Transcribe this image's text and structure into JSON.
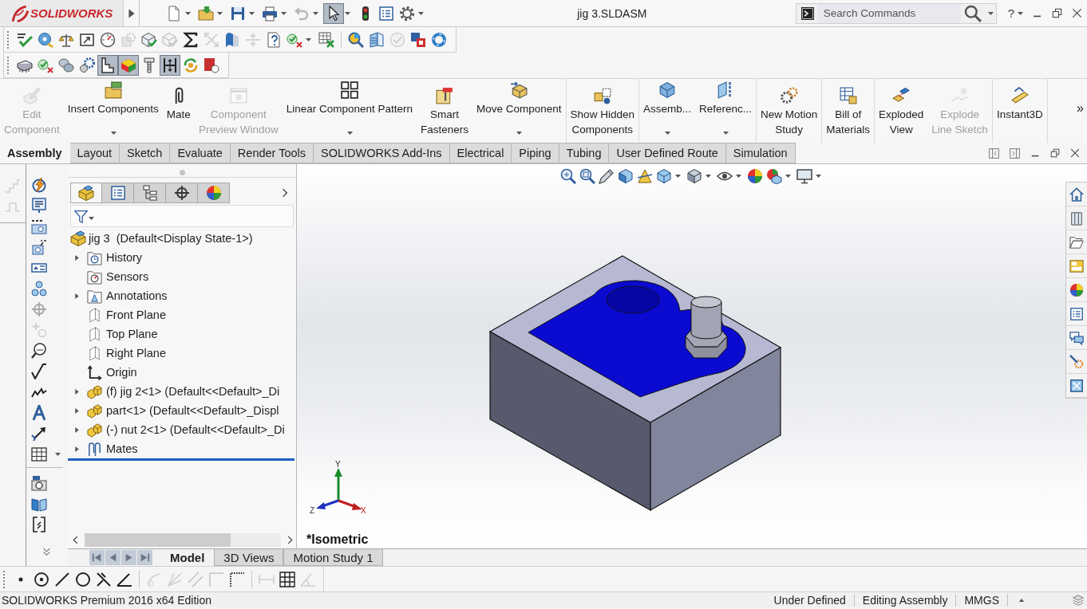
{
  "title_bar": {
    "logo_text": "SOLIDWORKS",
    "title": "jig 3.SLDASM",
    "search": {
      "placeholder": "Search Commands"
    },
    "help": "?"
  },
  "standard_toolbar": [
    {
      "disabled": false,
      "on": false
    },
    {
      "disabled": false,
      "on": false
    },
    {
      "disabled": false,
      "on": false
    },
    {
      "disabled": false,
      "on": false
    },
    {
      "disabled": true,
      "on": false
    },
    {
      "disabled": false,
      "on": true
    },
    {
      "disabled": false,
      "on": false
    },
    {
      "disabled": false,
      "on": false
    },
    {
      "disabled": false,
      "on": false
    }
  ],
  "toolbar_2": {
    "groups": [
      [
        {
          "disabled": false
        },
        {
          "disabled": false
        },
        {
          "disabled": false
        },
        {
          "disabled": false
        },
        {
          "disabled": false
        },
        {
          "disabled": true
        },
        {
          "disabled": false
        },
        {
          "disabled": true
        },
        {
          "disabled": false
        },
        {
          "disabled": true
        },
        {
          "disabled": false
        },
        {
          "disabled": true
        },
        {
          "disabled": false
        },
        {
          "disabled": false
        },
        {
          "disabled": false
        }
      ],
      [
        {
          "disabled": false
        },
        {
          "disabled": false
        },
        {
          "disabled": true
        },
        {
          "disabled": false
        },
        {
          "disabled": false
        }
      ]
    ]
  },
  "toolbar_3": [
    {
      "on": false
    },
    {
      "on": false
    },
    {
      "on": false
    },
    {
      "on": false
    },
    {
      "on": true
    },
    {
      "on": true
    },
    {
      "on": false
    },
    {
      "on": true
    },
    {
      "on": false
    },
    {
      "on": false
    }
  ],
  "command_manager": {
    "groups": [
      [
        {
          "label": "Edit\nComponent",
          "disabled": true,
          "dropdown": false
        },
        {
          "label": "Insert Components",
          "disabled": false,
          "dropdown": true
        },
        {
          "label": "Mate",
          "disabled": false,
          "dropdown": false
        },
        {
          "label": "Component\nPreview Window",
          "disabled": true,
          "dropdown": false
        },
        {
          "label": "Linear Component Pattern",
          "disabled": false,
          "dropdown": true
        },
        {
          "label": "Smart\nFasteners",
          "disabled": false,
          "dropdown": false
        },
        {
          "label": "Move Component",
          "disabled": false,
          "dropdown": true
        }
      ],
      [
        {
          "label": "Show Hidden\nComponents",
          "disabled": false,
          "dropdown": false
        }
      ],
      [
        {
          "label": "Assemb...",
          "disabled": false,
          "dropdown": true
        },
        {
          "label": "Referenc...",
          "disabled": false,
          "dropdown": true
        }
      ],
      [
        {
          "label": "New Motion\nStudy",
          "disabled": false,
          "dropdown": false
        }
      ],
      [
        {
          "label": "Bill of\nMaterials",
          "disabled": false,
          "dropdown": false
        }
      ],
      [
        {
          "label": "Exploded\nView",
          "disabled": false,
          "dropdown": false
        },
        {
          "label": "Explode\nLine Sketch",
          "disabled": true,
          "dropdown": false
        }
      ],
      [
        {
          "label": "Instant3D",
          "disabled": false,
          "dropdown": false
        }
      ]
    ],
    "more": "»"
  },
  "tabs": [
    {
      "label": "Assembly",
      "selected": true
    },
    {
      "label": "Layout",
      "selected": false
    },
    {
      "label": "Sketch",
      "selected": false
    },
    {
      "label": "Evaluate",
      "selected": false
    },
    {
      "label": "Render Tools",
      "selected": false
    },
    {
      "label": "SOLIDWORKS Add-Ins",
      "selected": false
    },
    {
      "label": "Electrical",
      "selected": false
    },
    {
      "label": "Piping",
      "selected": false
    },
    {
      "label": "Tubing",
      "selected": false
    },
    {
      "label": "User Defined Route",
      "selected": false
    },
    {
      "label": "Simulation",
      "selected": false
    }
  ],
  "left_toolbar": [
    {
      "disabled": true
    },
    {
      "disabled": true
    }
  ],
  "annotation_toolbar": {
    "groups": [
      [
        {
          "disabled": false
        },
        {
          "disabled": false
        },
        {
          "disabled": false
        },
        {
          "disabled": false
        },
        {
          "disabled": false
        },
        {
          "disabled": false
        },
        {
          "disabled": true
        },
        {
          "disabled": true
        },
        {
          "disabled": false
        },
        {
          "disabled": false
        },
        {
          "disabled": false
        },
        {
          "disabled": false
        },
        {
          "disabled": false
        },
        {
          "disabled": false
        }
      ],
      [
        {
          "disabled": false
        },
        {
          "disabled": false
        },
        {
          "disabled": false
        }
      ]
    ]
  },
  "feature_manager": {
    "tabs": [
      {
        "selected": true
      },
      {
        "selected": false
      },
      {
        "selected": false
      },
      {
        "selected": false
      },
      {
        "selected": false
      }
    ],
    "tree": {
      "label": "jig 3  (Default<Display State-1>)",
      "children": [
        {
          "label": "History",
          "expanded": false
        },
        {
          "label": "Sensors"
        },
        {
          "label": "Annotations",
          "expanded": false
        },
        {
          "label": "Front Plane"
        },
        {
          "label": "Top Plane"
        },
        {
          "label": "Right Plane"
        },
        {
          "label": "Origin"
        },
        {
          "label": "(f) jig 2<1> (Default<<Default>_Di",
          "expanded": false
        },
        {
          "label": "part<1> (Default<<Default>_Displ",
          "expanded": false
        },
        {
          "label": "(-) nut 2<1> (Default<<Default>_Di",
          "expanded": false
        },
        {
          "label": "Mates",
          "expanded": false
        }
      ]
    }
  },
  "graphics": {
    "view_name": "*Isometric",
    "triad": {
      "x": "X",
      "y": "Y",
      "z": "Z"
    }
  },
  "model_tabs": [
    {
      "label": "Model",
      "selected": true
    },
    {
      "label": "3D Views",
      "selected": false
    },
    {
      "label": "Motion Study 1",
      "selected": false
    }
  ],
  "sketch_toolbar": {
    "groups": [
      [
        {
          "disabled": false
        },
        {
          "disabled": false
        },
        {
          "disabled": false
        },
        {
          "disabled": false
        },
        {
          "disabled": false
        },
        {
          "disabled": false
        }
      ],
      [
        {
          "disabled": true
        },
        {
          "disabled": true
        },
        {
          "disabled": true
        },
        {
          "disabled": true
        },
        {
          "disabled": false
        }
      ],
      [
        {
          "disabled": true
        },
        {
          "disabled": false
        },
        {
          "disabled": true
        }
      ]
    ]
  },
  "status_bar": {
    "edition": "SOLIDWORKS Premium 2016 x64 Edition",
    "items": [
      "Under Defined",
      "Editing Assembly",
      "MMGS"
    ]
  }
}
